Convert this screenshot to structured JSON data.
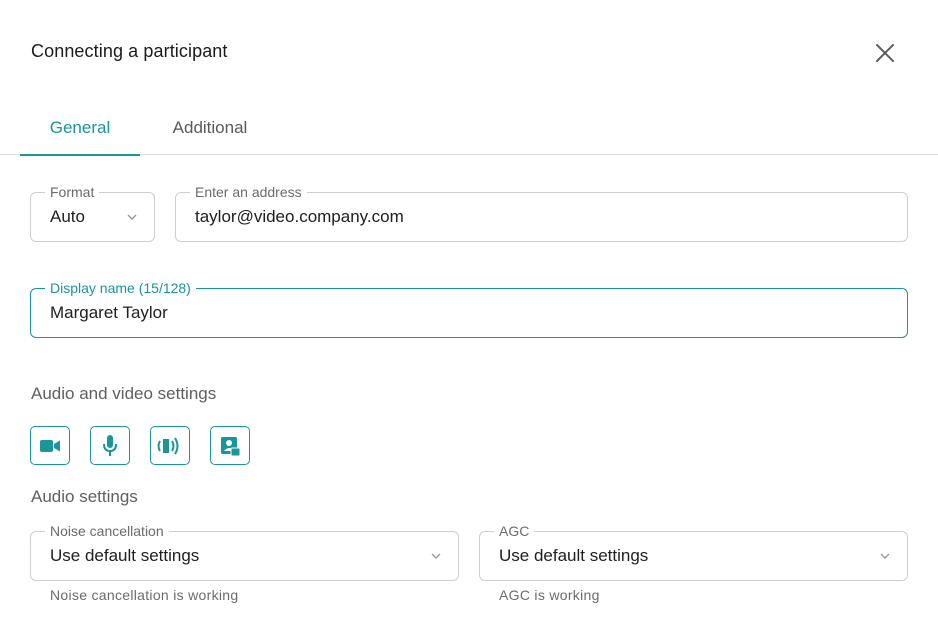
{
  "dialog": {
    "title": "Connecting a participant",
    "close_icon": "close-icon"
  },
  "tabs": [
    {
      "label": "General",
      "active": true
    },
    {
      "label": "Additional",
      "active": false
    }
  ],
  "form": {
    "format": {
      "legend": "Format",
      "value": "Auto"
    },
    "address": {
      "legend": "Enter an address",
      "value": "taylor@video.company.com"
    },
    "display_name": {
      "legend": "Display name (15/128)",
      "value": "Margaret Taylor"
    }
  },
  "sections": {
    "audio_video": "Audio and video settings",
    "audio": "Audio settings"
  },
  "media_buttons": [
    {
      "icon": "video-camera-icon"
    },
    {
      "icon": "microphone-icon"
    },
    {
      "icon": "speaker-icon"
    },
    {
      "icon": "screen-share-icon"
    }
  ],
  "audio_settings": {
    "noise": {
      "legend": "Noise cancellation",
      "value": "Use default settings",
      "helper": "Noise cancellation is working"
    },
    "agc": {
      "legend": "AGC",
      "value": "Use default settings",
      "helper": "AGC is working"
    }
  },
  "colors": {
    "accent": "#1a9599",
    "border": "#cfcfcf"
  }
}
